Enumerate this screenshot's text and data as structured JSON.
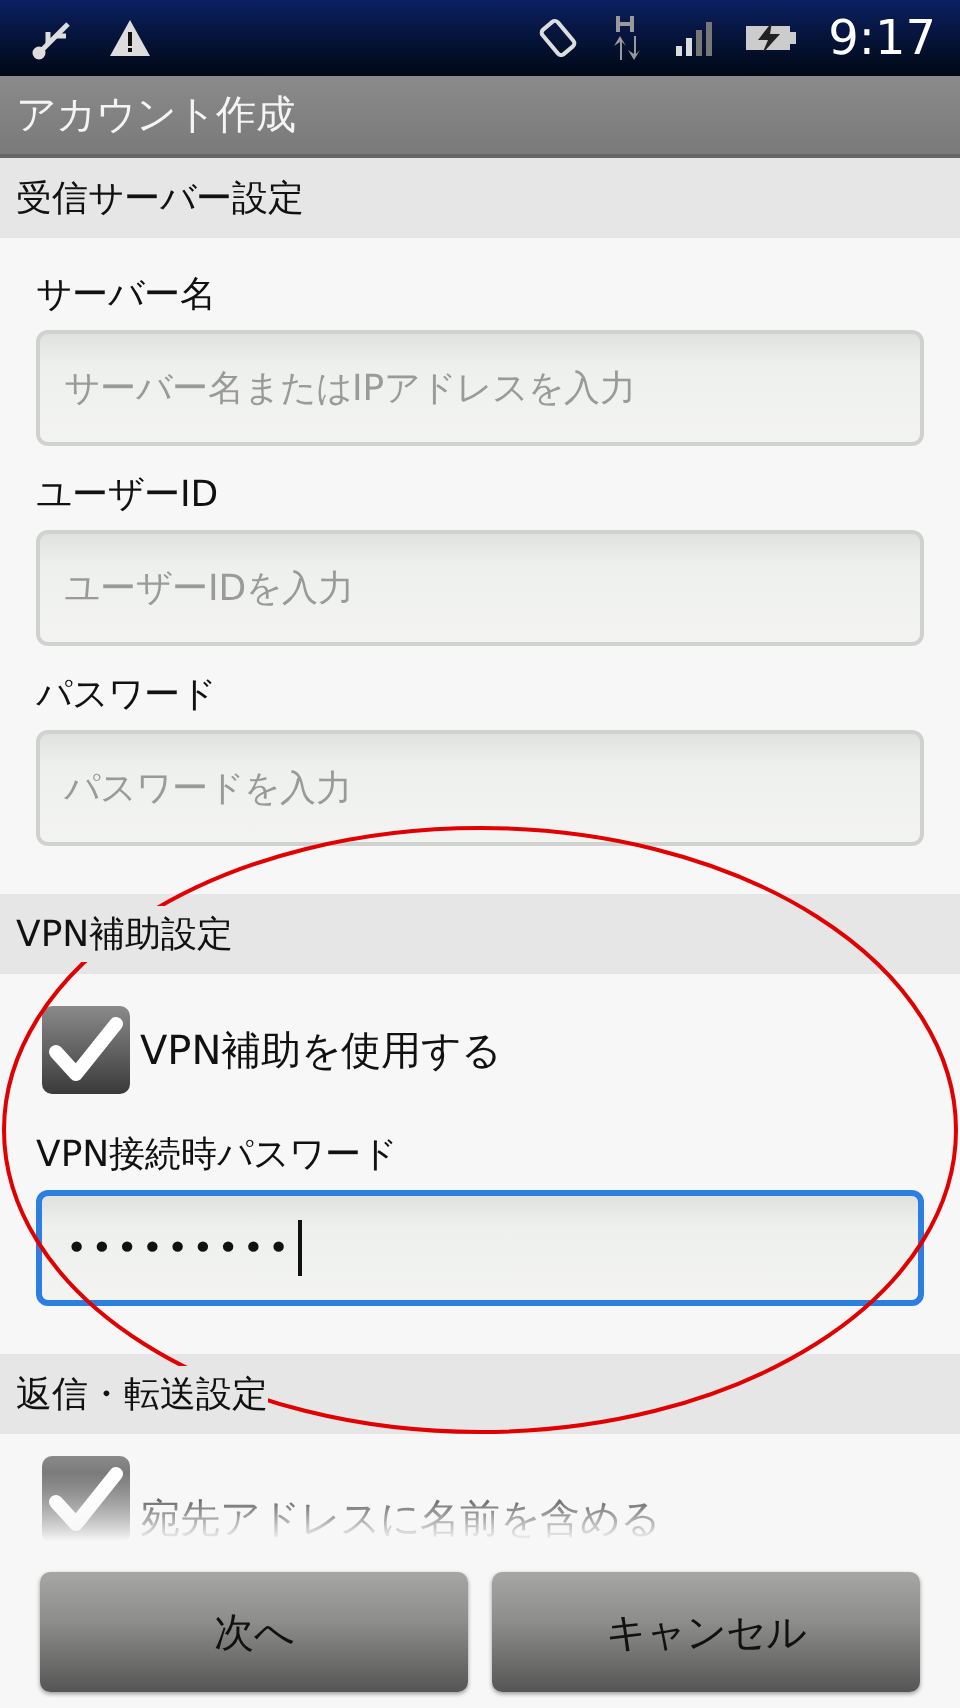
{
  "status_bar": {
    "time": "9:17"
  },
  "title": "アカウント作成",
  "sections": [
    {
      "header": "受信サーバー設定",
      "items": [
        {
          "kind": "field",
          "label": "サーバー名",
          "placeholder": "サーバー名またはIPアドレスを入力",
          "focused": false
        },
        {
          "kind": "field",
          "label": "ユーザーID",
          "placeholder": "ユーザーIDを入力",
          "focused": false
        },
        {
          "kind": "field",
          "label": "パスワード",
          "placeholder": "パスワードを入力",
          "focused": false
        }
      ]
    },
    {
      "header": "VPN補助設定",
      "items": [
        {
          "kind": "checkbox",
          "label": "VPN補助を使用する",
          "checked": true
        },
        {
          "kind": "field",
          "label": "VPN接続時パスワード",
          "value": "•••••••••",
          "focused": true
        }
      ]
    },
    {
      "header": "返信・転送設定",
      "items": [
        {
          "kind": "checkbox",
          "label": "宛先アドレスに名前を含める",
          "checked": true
        }
      ]
    }
  ],
  "buttons": [
    "次へ",
    "キャンセル"
  ],
  "annotation": {
    "kind": "ellipse"
  }
}
